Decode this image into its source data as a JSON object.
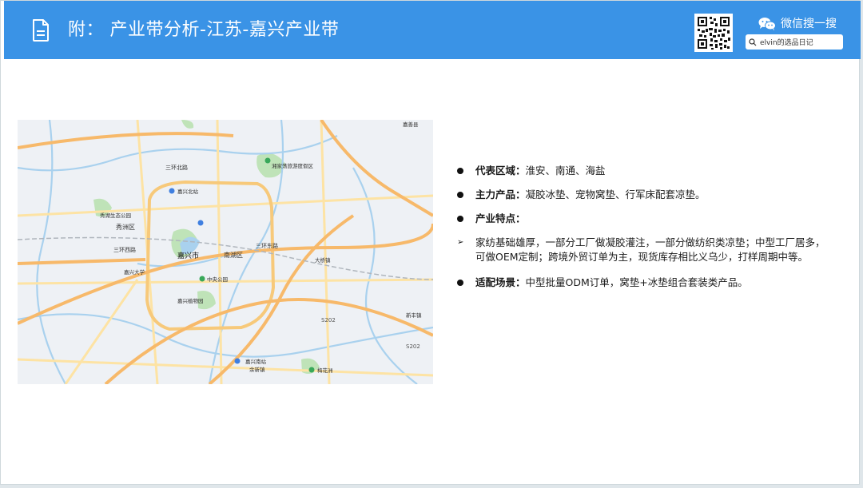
{
  "header": {
    "title": "附：  产业带分析-江苏-嘉兴产业带",
    "wechat_label": "微信搜一搜",
    "search_text": "elvin的选品日记"
  },
  "map": {
    "labels": {
      "road1": "三环北路",
      "road2": "三环东路",
      "road3": "三环西路",
      "district1": "秀洲区",
      "district2": "南湖区",
      "city": "嘉兴市",
      "poi1": "嘉兴北站",
      "poi2": "嘉兴南站",
      "poi3": "中央公园",
      "poi4": "嘉兴大学",
      "poi5": "梅花洲",
      "poi6": "嘉兴植物园",
      "poi7": "秀湖生态公园",
      "poi8": "湘家荡旅游度假区",
      "town1": "嘉善县",
      "town2": "大桥镇",
      "town3": "余新镇",
      "town4": "新丰镇",
      "hwy1": "S202",
      "hwy2": "S202"
    }
  },
  "content": {
    "item1_label": "代表区域：",
    "item1_text": "淮安、南通、海盐",
    "item2_label": "主力产品：",
    "item2_text": "凝胶冰垫、宠物窝垫、行军床配套凉垫。",
    "item3_label": "产业特点：",
    "item4_text": "家纺基础雄厚，一部分工厂做凝胶灌注，一部分做纺织类凉垫；中型工厂居多，可做OEM定制；跨境外贸订单为主，现货库存相比义乌少，打样周期中等。",
    "item5_label": "适配场景：",
    "item5_text": "中型批量ODM订单，窝垫+冰垫组合套装类产品。"
  },
  "colors": {
    "header_bg": "#3a93e6",
    "road_major": "#f7b96a",
    "road_minor": "#fde3a4",
    "water": "#a9d1ee",
    "park": "#bfe3b8"
  },
  "icons": [
    "document-icon",
    "qr-code",
    "wechat-icon",
    "search-icon",
    "map-pin-icon"
  ]
}
